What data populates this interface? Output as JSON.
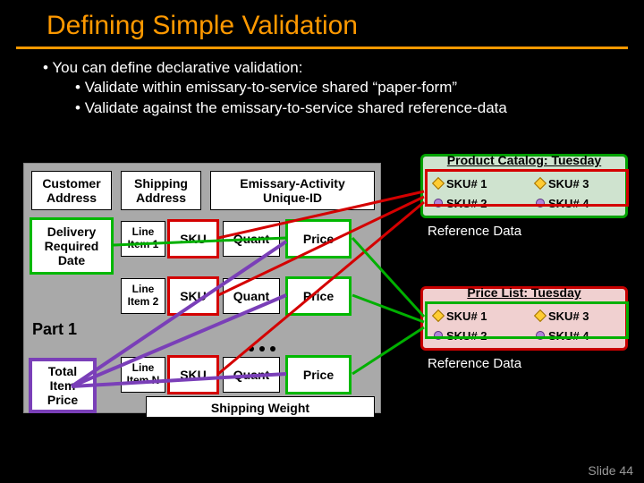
{
  "title": "Defining Simple Validation",
  "bullets": {
    "b1": "You can define declarative validation:",
    "b2": "Validate within emissary-to-service shared “paper-form”",
    "b3": "Validate against the emissary-to-service shared  reference-data"
  },
  "form": {
    "custAddr": "Customer\nAddress",
    "shipAddr": "Shipping\nAddress",
    "emActId": "Emissary-Activity\nUnique-ID",
    "delReqDate": "Delivery\nRequired\nDate",
    "part1": "Part 1",
    "lineItem1": "Line\nItem 1",
    "lineItem2": "Line\nItem 2",
    "lineItemN": "Line\nItem N",
    "sku": "SKU",
    "quant": "Quant",
    "price": "Price",
    "totalItemPrice": "Total\nItem\nPrice",
    "shipWeight": "Shipping Weight"
  },
  "ref1": {
    "title": "Product Catalog: Tuesday",
    "sku1": "SKU# 1",
    "sku2": "SKU# 2",
    "sku3": "SKU# 3",
    "sku4": "SKU# 4",
    "label": "Reference Data"
  },
  "ref2": {
    "title": "Price List: Tuesday",
    "sku1": "SKU# 1",
    "sku2": "SKU# 2",
    "sku3": "SKU# 3",
    "sku4": "SKU# 4",
    "label": "Reference Data"
  },
  "slideNum": "Slide 44"
}
